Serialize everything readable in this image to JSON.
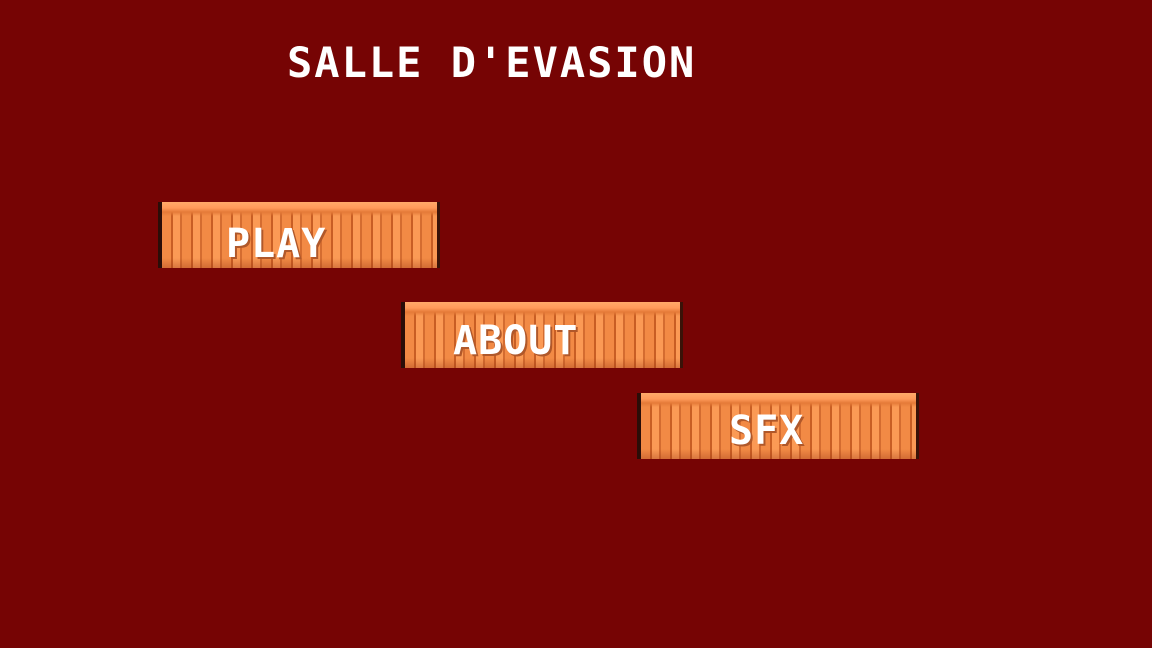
{
  "title": "SALLE D'EVASiON",
  "menu": {
    "play_label": "PLAY",
    "about_label": "ABOUT",
    "sfx_label": "SFX"
  },
  "colors": {
    "background": "#760404",
    "button_orange": "#ee8642",
    "text": "#ffffff"
  }
}
